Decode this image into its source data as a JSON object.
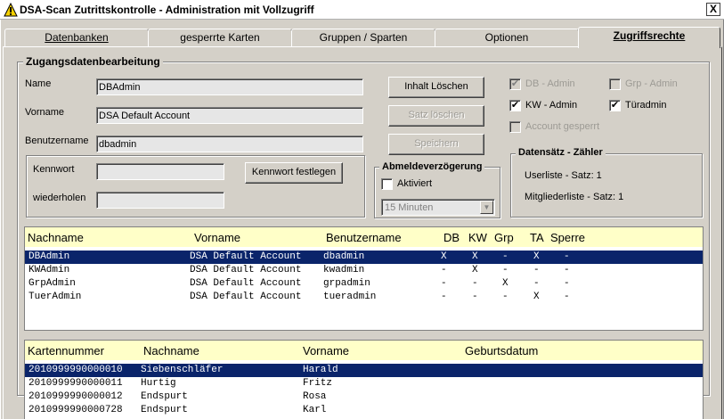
{
  "window": {
    "title": "DSA-Scan Zutrittskontrolle - Administration mit Vollzugriff",
    "close": "X"
  },
  "tabs": [
    "Datenbanken",
    "gesperrte Karten",
    "Gruppen / Sparten",
    "Optionen",
    "Zugriffsrechte"
  ],
  "access_group": {
    "title": "Zugangsdatenbearbeitung",
    "name_label": "Name",
    "name_value": "DBAdmin",
    "vorname_label": "Vorname",
    "vorname_value": "DSA Default Account",
    "benutzername_label": "Benutzername",
    "benutzername_value": "dbadmin",
    "kennwort_label": "Kennwort",
    "kennwort_value": "",
    "wiederholen_label": "wiederholen",
    "wiederholen_value": "",
    "set_password_button": "Kennwort festlegen"
  },
  "buttons": {
    "clear": "Inhalt Löschen",
    "delete": "Satz löschen",
    "save": "Speichern"
  },
  "permissions": {
    "db_admin": "DB - Admin",
    "grp_admin": "Grp - Admin",
    "kw_admin": "KW - Admin",
    "tueradmin": "Türadmin",
    "account_locked": "Account gesperrt"
  },
  "logout_delay": {
    "title": "Abmeldeverzögerung",
    "active_label": "Aktiviert",
    "selected": "15 Minuten"
  },
  "counter": {
    "title": "Datensätz - Zähler",
    "userlist": "Userliste - Satz: 1",
    "members": "Mitgliederliste - Satz: 1"
  },
  "user_table": {
    "headers": [
      "Nachname",
      "Vorname",
      "Benutzername",
      "DB",
      "KW",
      "Grp",
      "TA",
      "Sperre"
    ],
    "rows": [
      [
        "DBAdmin",
        "DSA Default Account",
        "dbadmin",
        "X",
        "X",
        "-",
        "X",
        "-"
      ],
      [
        "KWAdmin",
        "DSA Default Account",
        "kwadmin",
        "-",
        "X",
        "-",
        "-",
        "-"
      ],
      [
        "GrpAdmin",
        "DSA Default Account",
        "grpadmin",
        "-",
        "-",
        "X",
        "-",
        "-"
      ],
      [
        "TuerAdmin",
        "DSA Default Account",
        "tueradmin",
        "-",
        "-",
        "-",
        "X",
        "-"
      ]
    ]
  },
  "member_table": {
    "headers": [
      "Kartennummer",
      "Nachname",
      "Vorname",
      "Geburtsdatum"
    ],
    "rows": [
      [
        "2010999990000010",
        "Siebenschläfer",
        "Harald",
        ""
      ],
      [
        "2010999990000011",
        "Hurtig",
        "Fritz",
        ""
      ],
      [
        "2010999990000012",
        "Endspurt",
        "Rosa",
        ""
      ],
      [
        "2010999990000728",
        "Endspurt",
        "Karl",
        ""
      ]
    ]
  }
}
